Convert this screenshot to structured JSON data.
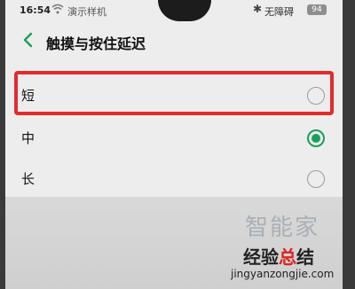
{
  "status_bar": {
    "time": "16:54",
    "carrier": "演示样机",
    "accessibility": "无障碍",
    "battery": "94"
  },
  "header": {
    "title": "触摸与按住延迟"
  },
  "options": [
    {
      "label": "短",
      "selected": false
    },
    {
      "label": "中",
      "selected": true
    },
    {
      "label": "长",
      "selected": false
    }
  ],
  "colors": {
    "accent": "#1aa05a",
    "highlight": "#e32b2b"
  },
  "watermark": {
    "big": "智能家",
    "main_prefix": "经验",
    "main_accent": "总",
    "main_suffix": "结",
    "url": "jingyanzongjie.com"
  }
}
